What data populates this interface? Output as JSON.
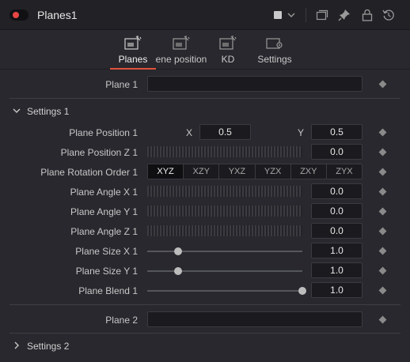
{
  "header": {
    "title": "Planes1",
    "toggle_color": "#e84545",
    "icons": [
      "color-swatch-icon",
      "chevron-down-icon",
      "window-icon",
      "pin-icon",
      "lock-icon",
      "reset-icon"
    ]
  },
  "tabs": [
    {
      "label": "Planes",
      "icon": "planes-tab-icon",
      "active": true
    },
    {
      "label": "Scene position",
      "icon": "scene-position-tab-icon",
      "active": false
    },
    {
      "label": "KD",
      "icon": "kd-tab-icon",
      "active": false
    },
    {
      "label": "Settings",
      "icon": "settings-tab-icon",
      "active": false
    }
  ],
  "plane1": {
    "label": "Plane 1",
    "value": ""
  },
  "settings1": {
    "title": "Settings 1",
    "expanded": true,
    "position": {
      "label": "Plane Position 1",
      "x_label": "X",
      "x_value": "0.5",
      "y_label": "Y",
      "y_value": "0.5"
    },
    "position_z": {
      "label": "Plane Position Z 1",
      "value": "0.0"
    },
    "rotation_order": {
      "label": "Plane Rotation Order 1",
      "options": [
        "XYZ",
        "XZY",
        "YXZ",
        "YZX",
        "ZXY",
        "ZYX"
      ],
      "selected": "XYZ"
    },
    "angle_x": {
      "label": "Plane Angle X 1",
      "value": "0.0"
    },
    "angle_y": {
      "label": "Plane Angle Y 1",
      "value": "0.0"
    },
    "angle_z": {
      "label": "Plane Angle Z 1",
      "value": "0.0"
    },
    "size_x": {
      "label": "Plane Size X 1",
      "value": "1.0",
      "slider_fraction": 0.2
    },
    "size_y": {
      "label": "Plane Size Y 1",
      "value": "1.0",
      "slider_fraction": 0.2
    },
    "blend": {
      "label": "Plane Blend 1",
      "value": "1.0",
      "slider_fraction": 1.0
    }
  },
  "plane2": {
    "label": "Plane 2",
    "value": ""
  },
  "settings2": {
    "title": "Settings 2",
    "expanded": false
  }
}
